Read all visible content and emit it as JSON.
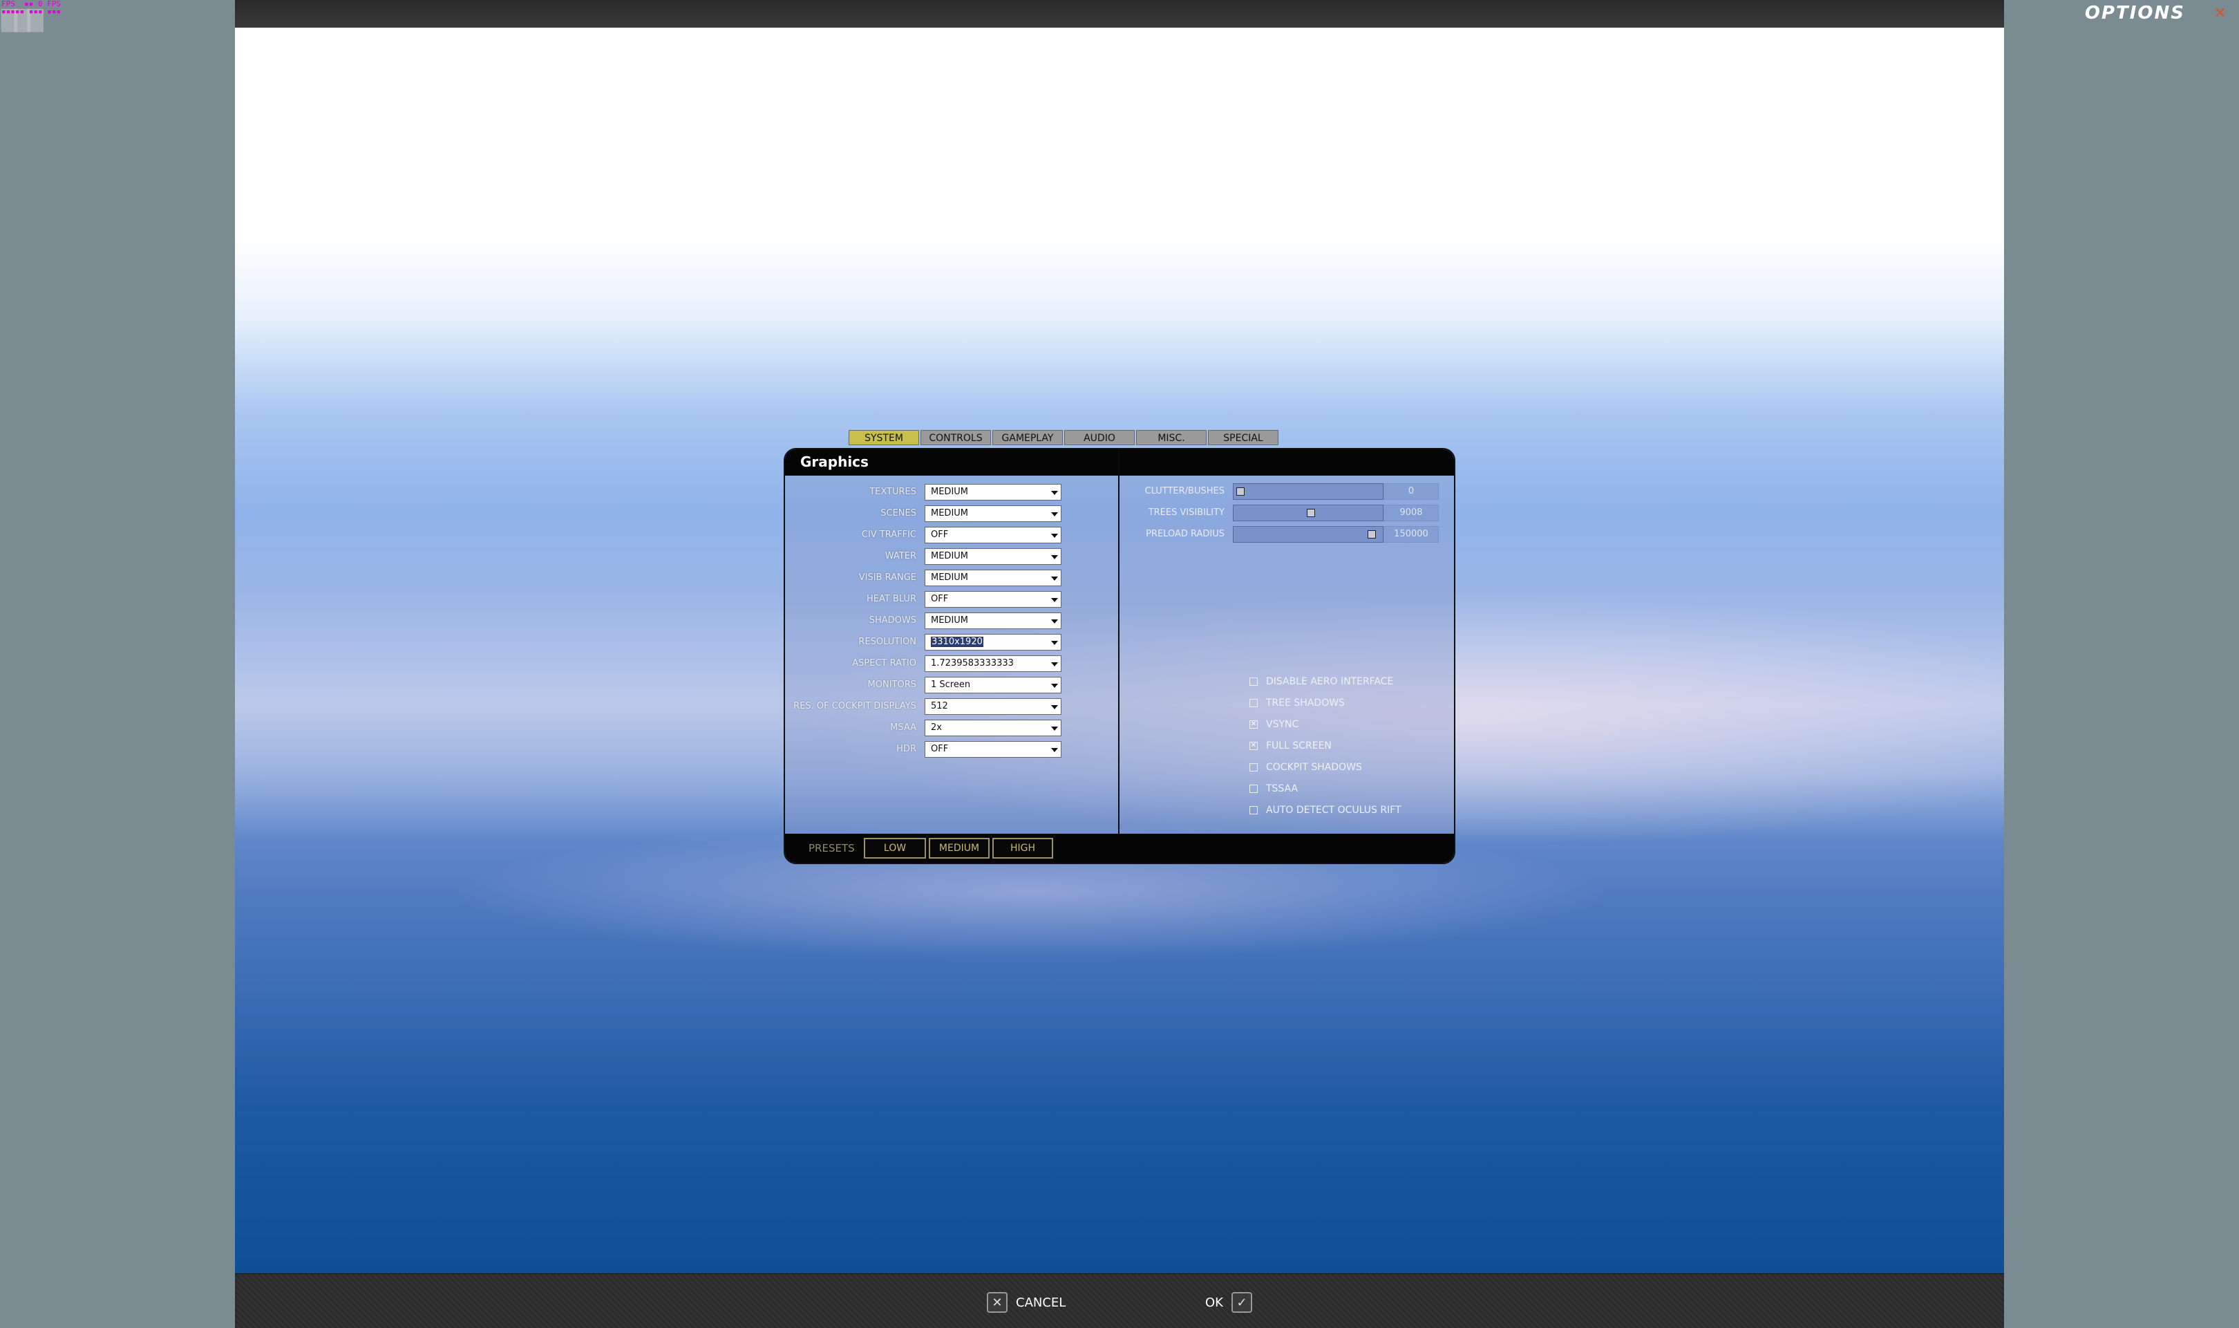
{
  "hud": {
    "fps_text": "FPS  ▪▪ 0 FPS\n▪▪▪▪▪ ▪▪▪ ▪▪▪"
  },
  "window": {
    "title": "OPTIONS",
    "close_icon": "×"
  },
  "tabs": [
    {
      "label": "SYSTEM",
      "active": true
    },
    {
      "label": "CONTROLS",
      "active": false
    },
    {
      "label": "GAMEPLAY",
      "active": false
    },
    {
      "label": "AUDIO",
      "active": false
    },
    {
      "label": "MISC.",
      "active": false
    },
    {
      "label": "SPECIAL",
      "active": false
    }
  ],
  "dialog": {
    "title": "Graphics"
  },
  "settings": [
    {
      "label": "TEXTURES",
      "value": "MEDIUM"
    },
    {
      "label": "SCENES",
      "value": "MEDIUM"
    },
    {
      "label": "CIV TRAFFIC",
      "value": "OFF"
    },
    {
      "label": "WATER",
      "value": "MEDIUM"
    },
    {
      "label": "VISIB RANGE",
      "value": "MEDIUM"
    },
    {
      "label": "HEAT BLUR",
      "value": "OFF"
    },
    {
      "label": "SHADOWS",
      "value": "MEDIUM"
    },
    {
      "label": "RESOLUTION",
      "value": "3310x1920"
    },
    {
      "label": "ASPECT RATIO",
      "value": "1.7239583333333"
    },
    {
      "label": "MONITORS",
      "value": "1 Screen"
    },
    {
      "label": "RES. OF COCKPIT DISPLAYS",
      "value": "512"
    },
    {
      "label": "MSAA",
      "value": "2x"
    },
    {
      "label": "HDR",
      "value": "OFF"
    }
  ],
  "sliders": [
    {
      "label": "CLUTTER/BUSHES",
      "value": "0",
      "level": 0.0
    },
    {
      "label": "TREES VISIBILITY",
      "value": "9008",
      "level": 0.52
    },
    {
      "label": "PRELOAD RADIUS",
      "value": "150000",
      "level": 0.97
    }
  ],
  "checkboxes": [
    {
      "label": "DISABLE AERO INTERFACE",
      "checked": false
    },
    {
      "label": "TREE SHADOWS",
      "checked": false
    },
    {
      "label": "VSYNC",
      "checked": true
    },
    {
      "label": "FULL SCREEN",
      "checked": true
    },
    {
      "label": "COCKPIT SHADOWS",
      "checked": false
    },
    {
      "label": "TSSAA",
      "checked": false
    },
    {
      "label": "AUTO DETECT OCULUS RIFT",
      "checked": false
    }
  ],
  "presets": {
    "label": "PRESETS",
    "low": "LOW",
    "medium": "MEDIUM",
    "high": "HIGH"
  },
  "footer": {
    "cancel_label": "CANCEL",
    "ok_label": "OK",
    "cancel_icon": "✕",
    "ok_icon": "✓"
  }
}
